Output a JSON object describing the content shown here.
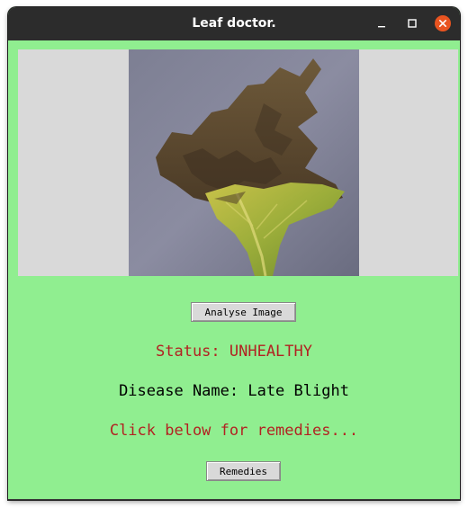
{
  "window": {
    "title": "Leaf doctor.",
    "controls": [
      "minimize-icon",
      "maximize-icon",
      "close-icon"
    ],
    "close_color": "#e95420",
    "background_color": "#90ee90"
  },
  "image": {
    "description_icon": "leaf-photo",
    "placeholder_color": "#d9d9d9"
  },
  "buttons": {
    "analyse_label": "Analyse Image",
    "remedies_label": "Remedies"
  },
  "result": {
    "status_text": "Status: UNHEALTHY",
    "status_color": "#b22222",
    "disease_text": "Disease Name: Late Blight",
    "remedy_prompt": "Click below for remedies...",
    "remedy_prompt_color": "#b22222"
  }
}
